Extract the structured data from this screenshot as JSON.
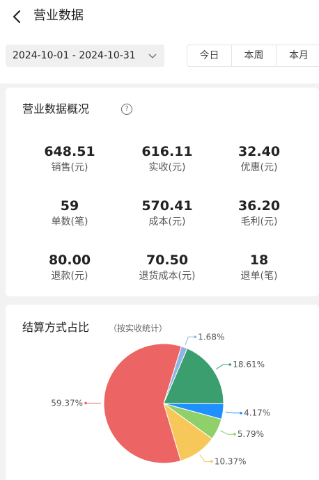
{
  "header": {
    "title": "营业数据",
    "back_icon": "chevron-left-icon"
  },
  "filter": {
    "date_range": "2024-10-01 - 2024-10-31",
    "date_icon": "chevron-down-icon",
    "periods": [
      "今日",
      "本周",
      "本月"
    ]
  },
  "overview": {
    "title": "营业数据概况",
    "help_icon": "question-circle-icon",
    "help_glyph": "?",
    "metrics": [
      {
        "value": "648.51",
        "label": "销售(元)"
      },
      {
        "value": "616.11",
        "label": "实收(元)"
      },
      {
        "value": "32.40",
        "label": "优惠(元)"
      },
      {
        "value": "59",
        "label": "单数(笔)"
      },
      {
        "value": "570.41",
        "label": "成本(元)"
      },
      {
        "value": "36.20",
        "label": "毛利(元)"
      },
      {
        "value": "80.00",
        "label": "退款(元)"
      },
      {
        "value": "70.50",
        "label": "退货成本(元)"
      },
      {
        "value": "18",
        "label": "退单(笔)"
      }
    ]
  },
  "payment": {
    "title": "结算方式占比",
    "subtitle": "（按实收统计）"
  },
  "chart_data": {
    "type": "pie",
    "slices": [
      {
        "value": 1.68,
        "label": "1.68%",
        "color": "#8db4e2"
      },
      {
        "value": 18.61,
        "label": "18.61%",
        "color": "#3a9e6f"
      },
      {
        "value": 4.17,
        "label": "4.17%",
        "color": "#1e90ff"
      },
      {
        "value": 5.79,
        "label": "5.79%",
        "color": "#8fd06a"
      },
      {
        "value": 10.37,
        "label": "10.37%",
        "color": "#f7c75a"
      },
      {
        "value": 59.37,
        "label": "59.37%",
        "color": "#ec6464"
      }
    ]
  }
}
